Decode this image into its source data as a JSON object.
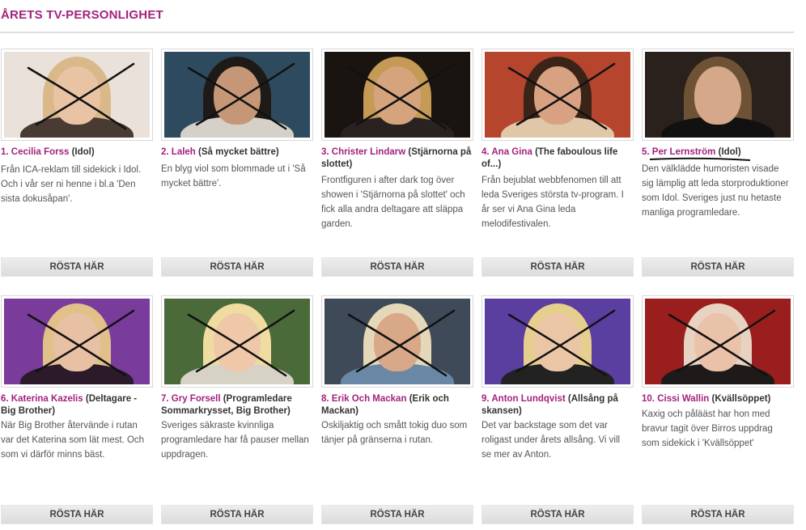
{
  "page_title": "ÅRETS TV-PERSONLIGHET",
  "vote_label": "RÖSTA HÄR",
  "colors": {
    "accent": "#a3227e",
    "rule": "#dedede",
    "button": "#e2e2e2"
  },
  "rows": [
    [
      {
        "rank": "1.",
        "name": "Cecilia Forss",
        "tag": "(Idol)",
        "desc": "Från ICA-reklam till sidekick i Idol. Och i vår ser ni henne i bl.a 'Den sista dokusåpan'.",
        "crossed": true,
        "bg": "#e9e1da",
        "hair": "#d9b98a",
        "face": "#e9c4a4",
        "body": "#4a3a34"
      },
      {
        "rank": "2.",
        "name": "Laleh",
        "tag": "(Så mycket bättre)",
        "desc": "En blyg viol som blommade ut i 'Så mycket bättre'.",
        "crossed": true,
        "bg": "#2e4a5e",
        "hair": "#1e1a18",
        "face": "#c69776",
        "body": "#d5d0c8"
      },
      {
        "rank": "3.",
        "name": "Christer Lindarw",
        "tag": "(Stjärnorna på slottet)",
        "desc": "Frontfiguren i after dark tog över showen i 'Stjärnorna på slottet' och fick alla andra deltagare att släppa garden.",
        "crossed": true,
        "bg": "#1a1410",
        "hair": "#c49a55",
        "face": "#d6a47c",
        "body": "#2a2220"
      },
      {
        "rank": "4.",
        "name": "Ana Gina",
        "tag": "(The faboulous life of...)",
        "desc": "Från bejublat webbfenomen till att leda Sveriges största tv-program. I år ser vi Ana Gina leda melodifestivalen.",
        "crossed": true,
        "bg": "#b5452c",
        "hair": "#3a2418",
        "face": "#d8a282",
        "body": "#e0c7a8"
      },
      {
        "rank": "5.",
        "name": "Per Lernström",
        "tag": "(Idol)",
        "desc": "Den välklädde humoristen visade sig lämplig att leda storproduktioner som Idol. Sveriges just nu hetaste manliga programledare.",
        "crossed": false,
        "bg": "#2a211c",
        "hair": "#6e5236",
        "face": "#d4a888",
        "body": "#111111"
      }
    ],
    [
      {
        "rank": "6.",
        "name": "Katerina Kazelis",
        "tag": "(Deltagare - Big Brother)",
        "desc": "När Big Brother återvände i rutan var det Katerina som lät mest. Och som vi därför minns bäst.",
        "crossed": true,
        "bg": "#7a3c9a",
        "hair": "#e2c08a",
        "face": "#e8c0a4",
        "body": "#2a1a2a"
      },
      {
        "rank": "7.",
        "name": "Gry Forsell",
        "tag": "(Programledare Sommarkrysset, Big Brother)",
        "desc": "Sveriges säkraste kvinnliga programledare har få pauser mellan uppdragen.",
        "crossed": true,
        "bg": "#4a6a3a",
        "hair": "#f0dca0",
        "face": "#eec8a8",
        "body": "#d7d2c6"
      },
      {
        "rank": "8.",
        "name": "Erik Och Mackan",
        "tag": "(Erik och Mackan)",
        "desc": "Oskiljaktig och smått tokig duo som tänjer på gränserna i rutan.",
        "crossed": true,
        "bg": "#3e4a58",
        "hair": "#e4d8b8",
        "face": "#d8a888",
        "body": "#6a88a6"
      },
      {
        "rank": "9.",
        "name": "Anton Lundqvist",
        "tag": "(Allsång på skansen)",
        "desc": "Det var backstage som det var roligast under årets allsång. Vi vill se mer av Anton.",
        "crossed": true,
        "bg": "#5a3fa0",
        "hair": "#e6cf8e",
        "face": "#eac6a6",
        "body": "#222222"
      },
      {
        "rank": "10.",
        "name": "Cissi Wallin",
        "tag": "(Kvällsöppet)",
        "desc": "Kaxig och pålääst har hon med bravur tagit över Birros uppdrag som sidekick i 'Kvällsöppet'",
        "crossed": true,
        "bg": "#9a1e1e",
        "hair": "#e8d2c2",
        "face": "#eac2aa",
        "body": "#1e1a1a"
      }
    ]
  ]
}
